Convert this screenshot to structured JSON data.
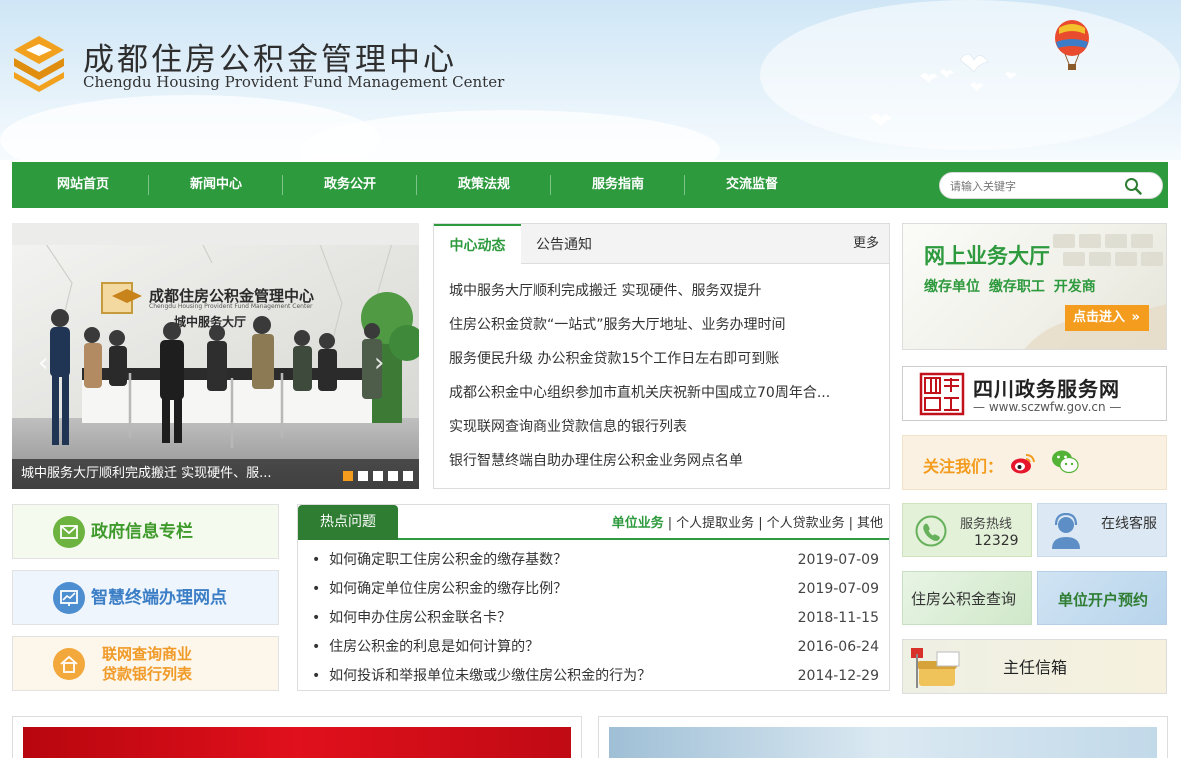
{
  "header": {
    "title": "成都住房公积金管理中心",
    "subtitle": "Chengdu Housing Provident Fund Management Center",
    "logo_icon": "housing-fund-logo-icon"
  },
  "nav": {
    "items": [
      "网站首页",
      "新闻中心",
      "政务公开",
      "政策法规",
      "服务指南",
      "交流监督"
    ],
    "search_placeholder": "请输入关键字",
    "search_icon": "search-icon",
    "color": "#2e9a3e"
  },
  "slider": {
    "caption": "城中服务大厅顺利完成搬迁 实现硬件、服...",
    "sign_title": "成都住房公积金管理中心",
    "sign_subtitle": "Chengdu Housing Provident Fund Management Center",
    "hall_name": "城中服务大厅",
    "slide_count": 5,
    "active_slide": 1
  },
  "news": {
    "tabs": [
      "中心动态",
      "公告通知"
    ],
    "more": "更多",
    "items": [
      "城中服务大厅顺利完成搬迁 实现硬件、服务双提升",
      "住房公积金贷款“一站式”服务大厅地址、业务办理时间",
      "服务便民升级 办公积金贷款15个工作日左右即可到账",
      "成都公积金中心组织参加市直机关庆祝新中国成立70周年合...",
      "实现联网查询商业贷款信息的银行列表",
      "银行智慧终端自助办理住房公积金业务网点名单"
    ]
  },
  "biz_hall": {
    "title": "网上业务大厅",
    "subs": [
      "缴存单位",
      "缴存职工",
      "开发商"
    ],
    "enter": "点击进入"
  },
  "sczwfw": {
    "title": "四川政务服务网",
    "url": "— www.sczwfw.gov.cn —"
  },
  "follow": {
    "label": "关注我们：",
    "icons": [
      "weibo-icon",
      "wechat-icon"
    ]
  },
  "services": {
    "hotline_label": "服务热线",
    "hotline_number": "12329",
    "online": "在线客服",
    "gjj_query": "住房公积金查询",
    "open_account": "单位开户预约",
    "director": "主任信箱"
  },
  "left_buttons": {
    "gov_info": "政府信息专栏",
    "terminal": "智慧终端办理网点",
    "bank_query_line1": "联网查询商业",
    "bank_query_line2": "贷款银行列表"
  },
  "hot": {
    "tab": "热点问题",
    "categories": [
      "单位业务",
      "个人提取业务",
      "个人贷款业务",
      "其他"
    ],
    "items": [
      {
        "q": "如何确定职工住房公积金的缴存基数？",
        "date": "2019-07-09"
      },
      {
        "q": "如何确定单位住房公积金的缴存比例？",
        "date": "2019-07-09"
      },
      {
        "q": "如何申办住房公积金联名卡？",
        "date": "2018-11-15"
      },
      {
        "q": "住房公积金的利息是如何计算的？",
        "date": "2016-06-24"
      },
      {
        "q": "如何投诉和举报单位未缴或少缴住房公积金的行为？",
        "date": "2014-12-29"
      }
    ]
  },
  "colors": {
    "primary_green": "#2e9a3e",
    "orange": "#f39c1e"
  }
}
